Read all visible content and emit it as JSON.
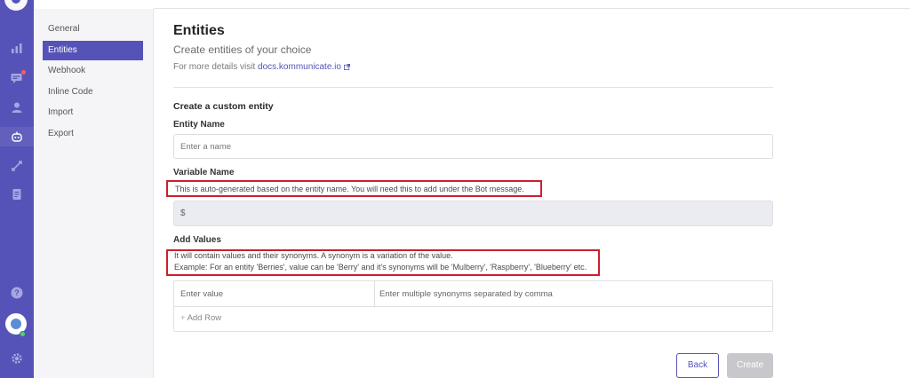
{
  "subnav": {
    "items": [
      {
        "label": "General"
      },
      {
        "label": "Entities",
        "active": true
      },
      {
        "label": "Webhook"
      },
      {
        "label": "Inline Code"
      },
      {
        "label": "Import"
      },
      {
        "label": "Export"
      }
    ]
  },
  "rail": {
    "icons": [
      "logo-icon",
      "analytics-icon",
      "conversations-icon",
      "users-icon",
      "bot-icon",
      "integrations-icon",
      "reports-icon",
      "help-icon",
      "avatar",
      "settings-icon"
    ],
    "accent": "#5553b7"
  },
  "page": {
    "title": "Entities",
    "subtitle": "Create entities of your choice",
    "details_prefix": "For more details visit ",
    "details_link": "docs.kommunicate.io"
  },
  "form": {
    "section_title": "Create a custom entity",
    "entity_name_label": "Entity Name",
    "entity_name_placeholder": "Enter a name",
    "variable_name_label": "Variable Name",
    "variable_name_help": "This is auto-generated based on the entity name. You will need this to add under the Bot message.",
    "variable_prefix": "$",
    "add_values_label": "Add Values",
    "add_values_help_1": "It will contain values and their synonyms. A synonym is a variation of the value.",
    "add_values_help_2": "Example: For an entity 'Berries', value can be 'Berry' and it's synonyms will be 'Mulberry', 'Raspberry', 'Blueberry' etc.",
    "value_placeholder": "Enter value",
    "synonyms_placeholder": "Enter multiple synonyms separated by comma",
    "add_row_label": "Add Row"
  },
  "actions": {
    "back_label": "Back",
    "create_label": "Create"
  },
  "colors": {
    "highlight": "#cc1f2e",
    "accent": "#5553b7"
  }
}
